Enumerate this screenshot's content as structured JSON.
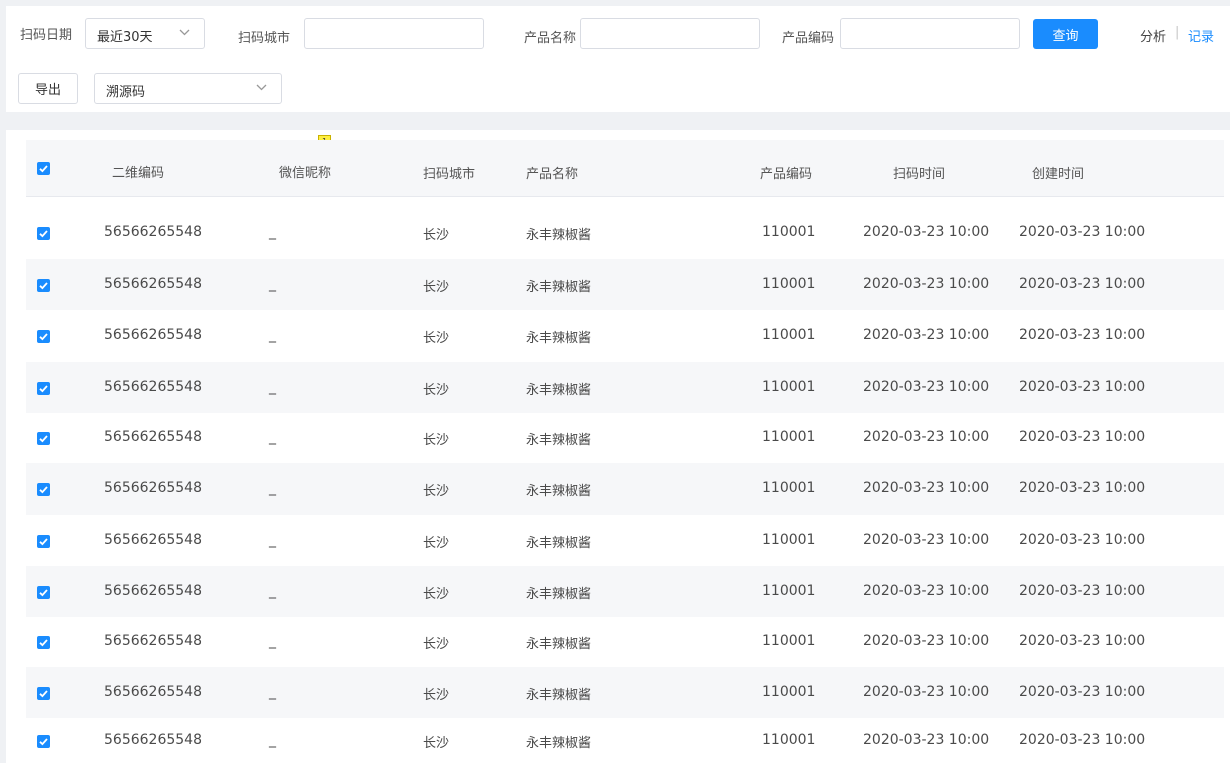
{
  "filters": {
    "scan_date_label": "扫码日期",
    "scan_date_value": "最近30天",
    "scan_city_label": "扫码城市",
    "scan_city_value": "",
    "product_name_label": "产品名称",
    "product_name_value": "",
    "product_code_label": "产品编码",
    "product_code_value": "",
    "query_button": "查询",
    "analysis_link": "分析",
    "separator": "|",
    "records_link": "记录",
    "export_button": "导出",
    "source_code_select": "溯源码"
  },
  "table": {
    "header_badge": "1",
    "columns": [
      "二维编码",
      "微信昵称",
      "扫码城市",
      "产品名称",
      "产品编码",
      "扫码时间",
      "创建时间"
    ],
    "rows": [
      {
        "qr_code": "56566265548",
        "nickname": "_",
        "city": "长沙",
        "product": "永丰辣椒酱",
        "code": "110001",
        "scan_time": "2020-03-23 10:00",
        "create_time": "2020-03-23 10:00"
      },
      {
        "qr_code": "56566265548",
        "nickname": "_",
        "city": "长沙",
        "product": "永丰辣椒酱",
        "code": "110001",
        "scan_time": "2020-03-23 10:00",
        "create_time": "2020-03-23 10:00"
      },
      {
        "qr_code": "56566265548",
        "nickname": "_",
        "city": "长沙",
        "product": "永丰辣椒酱",
        "code": "110001",
        "scan_time": "2020-03-23 10:00",
        "create_time": "2020-03-23 10:00"
      },
      {
        "qr_code": "56566265548",
        "nickname": "_",
        "city": "长沙",
        "product": "永丰辣椒酱",
        "code": "110001",
        "scan_time": "2020-03-23 10:00",
        "create_time": "2020-03-23 10:00"
      },
      {
        "qr_code": "56566265548",
        "nickname": "_",
        "city": "长沙",
        "product": "永丰辣椒酱",
        "code": "110001",
        "scan_time": "2020-03-23 10:00",
        "create_time": "2020-03-23 10:00"
      },
      {
        "qr_code": "56566265548",
        "nickname": "_",
        "city": "长沙",
        "product": "永丰辣椒酱",
        "code": "110001",
        "scan_time": "2020-03-23 10:00",
        "create_time": "2020-03-23 10:00"
      },
      {
        "qr_code": "56566265548",
        "nickname": "_",
        "city": "长沙",
        "product": "永丰辣椒酱",
        "code": "110001",
        "scan_time": "2020-03-23 10:00",
        "create_time": "2020-03-23 10:00"
      },
      {
        "qr_code": "56566265548",
        "nickname": "_",
        "city": "长沙",
        "product": "永丰辣椒酱",
        "code": "110001",
        "scan_time": "2020-03-23 10:00",
        "create_time": "2020-03-23 10:00"
      },
      {
        "qr_code": "56566265548",
        "nickname": "_",
        "city": "长沙",
        "product": "永丰辣椒酱",
        "code": "110001",
        "scan_time": "2020-03-23 10:00",
        "create_time": "2020-03-23 10:00"
      },
      {
        "qr_code": "56566265548",
        "nickname": "_",
        "city": "长沙",
        "product": "永丰辣椒酱",
        "code": "110001",
        "scan_time": "2020-03-23 10:00",
        "create_time": "2020-03-23 10:00"
      },
      {
        "qr_code": "56566265548",
        "nickname": "_",
        "city": "长沙",
        "product": "永丰辣椒酱",
        "code": "110001",
        "scan_time": "2020-03-23 10:00",
        "create_time": "2020-03-23 10:00"
      }
    ]
  },
  "colors": {
    "accent": "#1a8cfe",
    "stripe": "#f6f7f9",
    "background": "#eff1f4"
  },
  "icons": {
    "checkbox": "checkmark-icon",
    "dropdown": "chevron-down-icon"
  }
}
